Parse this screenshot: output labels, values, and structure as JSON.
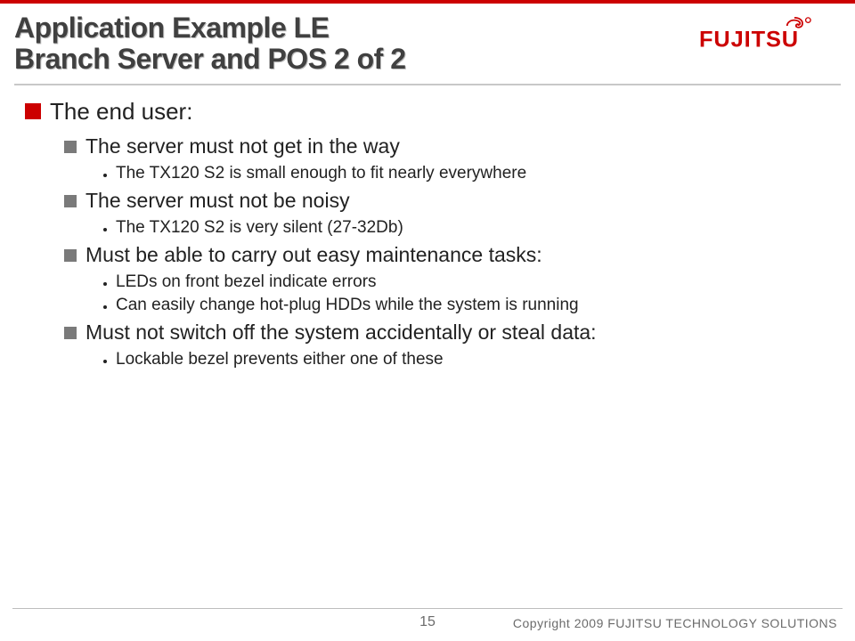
{
  "title": {
    "line1": "Application Example LE",
    "line2": "Branch Server and POS 2 of 2"
  },
  "logo": {
    "text": "FUJITSU",
    "color": "#c00"
  },
  "bullets": {
    "l1": "The end user:",
    "l2a": "The server must not get in the way",
    "l3a1": "The TX120 S2 is small enough to fit nearly everywhere",
    "l2b": "The server must not be noisy",
    "l3b1": "The TX120 S2 is very silent (27-32Db)",
    "l2c": "Must be able to carry out easy maintenance tasks:",
    "l3c1": "LEDs on front bezel indicate errors",
    "l3c2": "Can easily change hot-plug HDDs while the system is running",
    "l2d": "Must not switch off the system accidentally or steal data:",
    "l3d1": "Lockable bezel prevents either one of these"
  },
  "footer": {
    "page": "15",
    "copyright": "Copyright 2009 FUJITSU TECHNOLOGY SOLUTIONS"
  }
}
